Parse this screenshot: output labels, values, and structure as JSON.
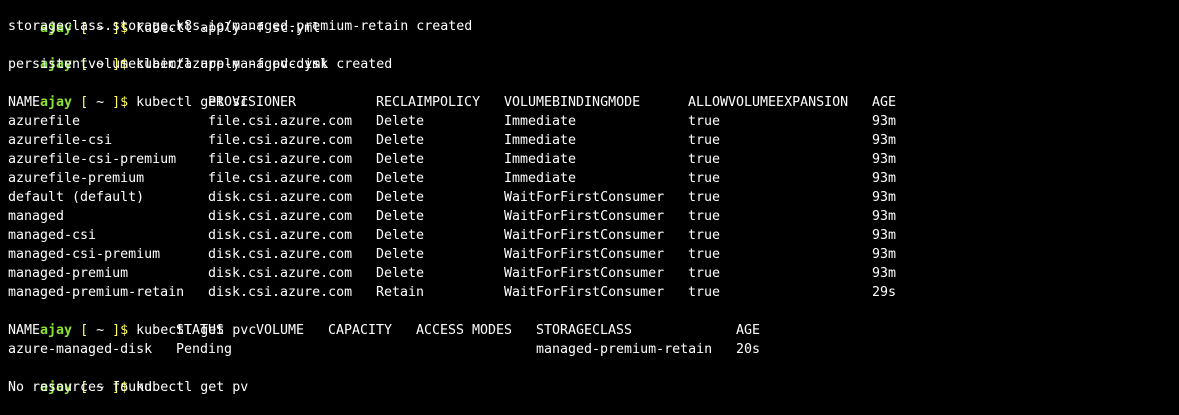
{
  "theme": {
    "background": "#000000",
    "foreground": "#ffffff",
    "user_color": "#8ae234",
    "bracket_color": "#ffff55"
  },
  "prompt": {
    "user": "ajay",
    "open": "[",
    "dir": "~",
    "close": "]$"
  },
  "commands": {
    "apply_sc": "kubectl apply -f sc.yml",
    "apply_sc_out": "storageclass.storage.k8s.io/managed-premium-retain created",
    "apply_pvc": "kubectl apply -f pvc.yml",
    "apply_pvc_out": "persistentvolumeclaim/azure-managed-disk created",
    "get_sc": "kubectl get sc",
    "get_pvc": "kubectl get pvc",
    "get_pv": "kubectl get pv",
    "get_pv_out": "No resources found"
  },
  "sc_table": {
    "headers": [
      "NAME",
      "PROVISIONER",
      "RECLAIMPOLICY",
      "VOLUMEBINDINGMODE",
      "ALLOWVOLUMEEXPANSION",
      "AGE"
    ],
    "rows": [
      [
        "azurefile",
        "file.csi.azure.com",
        "Delete",
        "Immediate",
        "true",
        "93m"
      ],
      [
        "azurefile-csi",
        "file.csi.azure.com",
        "Delete",
        "Immediate",
        "true",
        "93m"
      ],
      [
        "azurefile-csi-premium",
        "file.csi.azure.com",
        "Delete",
        "Immediate",
        "true",
        "93m"
      ],
      [
        "azurefile-premium",
        "file.csi.azure.com",
        "Delete",
        "Immediate",
        "true",
        "93m"
      ],
      [
        "default (default)",
        "disk.csi.azure.com",
        "Delete",
        "WaitForFirstConsumer",
        "true",
        "93m"
      ],
      [
        "managed",
        "disk.csi.azure.com",
        "Delete",
        "WaitForFirstConsumer",
        "true",
        "93m"
      ],
      [
        "managed-csi",
        "disk.csi.azure.com",
        "Delete",
        "WaitForFirstConsumer",
        "true",
        "93m"
      ],
      [
        "managed-csi-premium",
        "disk.csi.azure.com",
        "Delete",
        "WaitForFirstConsumer",
        "true",
        "93m"
      ],
      [
        "managed-premium",
        "disk.csi.azure.com",
        "Delete",
        "WaitForFirstConsumer",
        "true",
        "93m"
      ],
      [
        "managed-premium-retain",
        "disk.csi.azure.com",
        "Retain",
        "WaitForFirstConsumer",
        "true",
        "29s"
      ]
    ]
  },
  "pvc_table": {
    "headers": [
      "NAME",
      "STATUS",
      "VOLUME",
      "CAPACITY",
      "ACCESS MODES",
      "STORAGECLASS",
      "AGE"
    ],
    "rows": [
      [
        "azure-managed-disk",
        "Pending",
        "",
        "",
        "",
        "managed-premium-retain",
        "20s"
      ]
    ]
  }
}
